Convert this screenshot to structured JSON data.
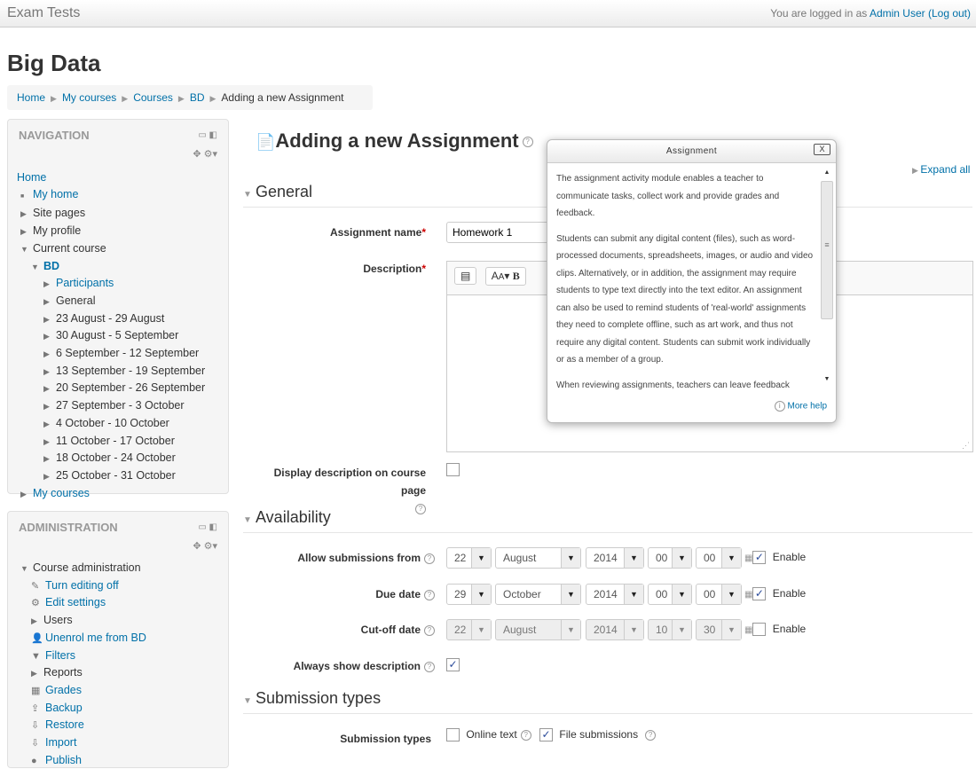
{
  "header": {
    "site_name": "Exam Tests",
    "login_prefix": "You are logged in as ",
    "user": "Admin User",
    "logout": "(Log out)"
  },
  "page_heading": "Big Data",
  "breadcrumb": [
    "Home",
    "My courses",
    "Courses",
    "BD",
    "Adding a new Assignment"
  ],
  "navigation": {
    "title": "NAVIGATION",
    "items": [
      {
        "label": "Home",
        "level": 0,
        "link": true,
        "icon": "none"
      },
      {
        "label": "My home",
        "level": 1,
        "link": true,
        "icon": "bullet"
      },
      {
        "label": "Site pages",
        "level": 1,
        "link": false,
        "icon": "collapsed"
      },
      {
        "label": "My profile",
        "level": 1,
        "link": false,
        "icon": "collapsed"
      },
      {
        "label": "Current course",
        "level": 1,
        "link": false,
        "icon": "expanded"
      },
      {
        "label": "BD",
        "level": 2,
        "link": true,
        "icon": "expanded",
        "bold": true
      },
      {
        "label": "Participants",
        "level": 3,
        "link": true,
        "icon": "collapsed"
      },
      {
        "label": "General",
        "level": 3,
        "link": false,
        "icon": "collapsed"
      },
      {
        "label": "23 August - 29 August",
        "level": 3,
        "link": false,
        "icon": "collapsed"
      },
      {
        "label": "30 August - 5 September",
        "level": 3,
        "link": false,
        "icon": "collapsed"
      },
      {
        "label": "6 September - 12 September",
        "level": 3,
        "link": false,
        "icon": "collapsed"
      },
      {
        "label": "13 September - 19 September",
        "level": 3,
        "link": false,
        "icon": "collapsed"
      },
      {
        "label": "20 September - 26 September",
        "level": 3,
        "link": false,
        "icon": "collapsed"
      },
      {
        "label": "27 September - 3 October",
        "level": 3,
        "link": false,
        "icon": "collapsed"
      },
      {
        "label": "4 October - 10 October",
        "level": 3,
        "link": false,
        "icon": "collapsed"
      },
      {
        "label": "11 October - 17 October",
        "level": 3,
        "link": false,
        "icon": "collapsed"
      },
      {
        "label": "18 October - 24 October",
        "level": 3,
        "link": false,
        "icon": "collapsed"
      },
      {
        "label": "25 October - 31 October",
        "level": 3,
        "link": false,
        "icon": "collapsed"
      },
      {
        "label": "My courses",
        "level": 1,
        "link": true,
        "icon": "collapsed"
      }
    ]
  },
  "administration": {
    "title": "ADMINISTRATION",
    "items": [
      {
        "label": "Course administration",
        "level": 1,
        "link": false,
        "icon": "expanded"
      },
      {
        "label": "Turn editing off",
        "level": 2,
        "link": true,
        "icon": "pencil"
      },
      {
        "label": "Edit settings",
        "level": 2,
        "link": true,
        "icon": "gear"
      },
      {
        "label": "Users",
        "level": 2,
        "link": false,
        "icon": "collapsed"
      },
      {
        "label": "Unenrol me from BD",
        "level": 2,
        "link": true,
        "icon": "user"
      },
      {
        "label": "Filters",
        "level": 2,
        "link": true,
        "icon": "filter"
      },
      {
        "label": "Reports",
        "level": 2,
        "link": false,
        "icon": "collapsed"
      },
      {
        "label": "Grades",
        "level": 2,
        "link": true,
        "icon": "grades"
      },
      {
        "label": "Backup",
        "level": 2,
        "link": true,
        "icon": "backup"
      },
      {
        "label": "Restore",
        "level": 2,
        "link": true,
        "icon": "restore"
      },
      {
        "label": "Import",
        "level": 2,
        "link": true,
        "icon": "import"
      },
      {
        "label": "Publish",
        "level": 2,
        "link": true,
        "icon": "publish"
      }
    ]
  },
  "main": {
    "title": "Adding a new Assignment",
    "expand_all": "Expand all",
    "general": {
      "legend": "General",
      "assignment_name_label": "Assignment name",
      "assignment_name_value": "Homework 1",
      "description_label": "Description",
      "display_description_label": "Display description on course page",
      "display_description_checked": false
    },
    "availability": {
      "legend": "Availability",
      "rows": [
        {
          "label": "Allow submissions from",
          "day": "22",
          "month": "August",
          "year": "2014",
          "hour": "00",
          "minute": "00",
          "enable_label": "Enable",
          "enabled": true
        },
        {
          "label": "Due date",
          "day": "29",
          "month": "October",
          "year": "2014",
          "hour": "00",
          "minute": "00",
          "enable_label": "Enable",
          "enabled": true
        },
        {
          "label": "Cut-off date",
          "day": "22",
          "month": "August",
          "year": "2014",
          "hour": "10",
          "minute": "30",
          "enable_label": "Enable",
          "enabled": false
        }
      ],
      "always_show_label": "Always show description",
      "always_show_checked": true
    },
    "submission_types": {
      "legend": "Submission types",
      "label": "Submission types",
      "online_text": "Online text",
      "online_text_checked": false,
      "file_submissions": "File submissions",
      "file_submissions_checked": true
    }
  },
  "popup": {
    "title": "Assignment",
    "close": "X",
    "paragraphs": [
      "The assignment activity module enables a teacher to communicate tasks, collect work and provide grades and feedback.",
      "Students can submit any digital content (files), such as word-processed documents, spreadsheets, images, or audio and video clips. Alternatively, or in addition, the assignment may require students to type text directly into the text editor. An assignment can also be used to remind students of 'real-world' assignments they need to complete offline, such as art work, and thus not require any digital content. Students can submit work individually or as a member of a group.",
      "When reviewing assignments, teachers can leave feedback"
    ],
    "more_help": "More help"
  }
}
